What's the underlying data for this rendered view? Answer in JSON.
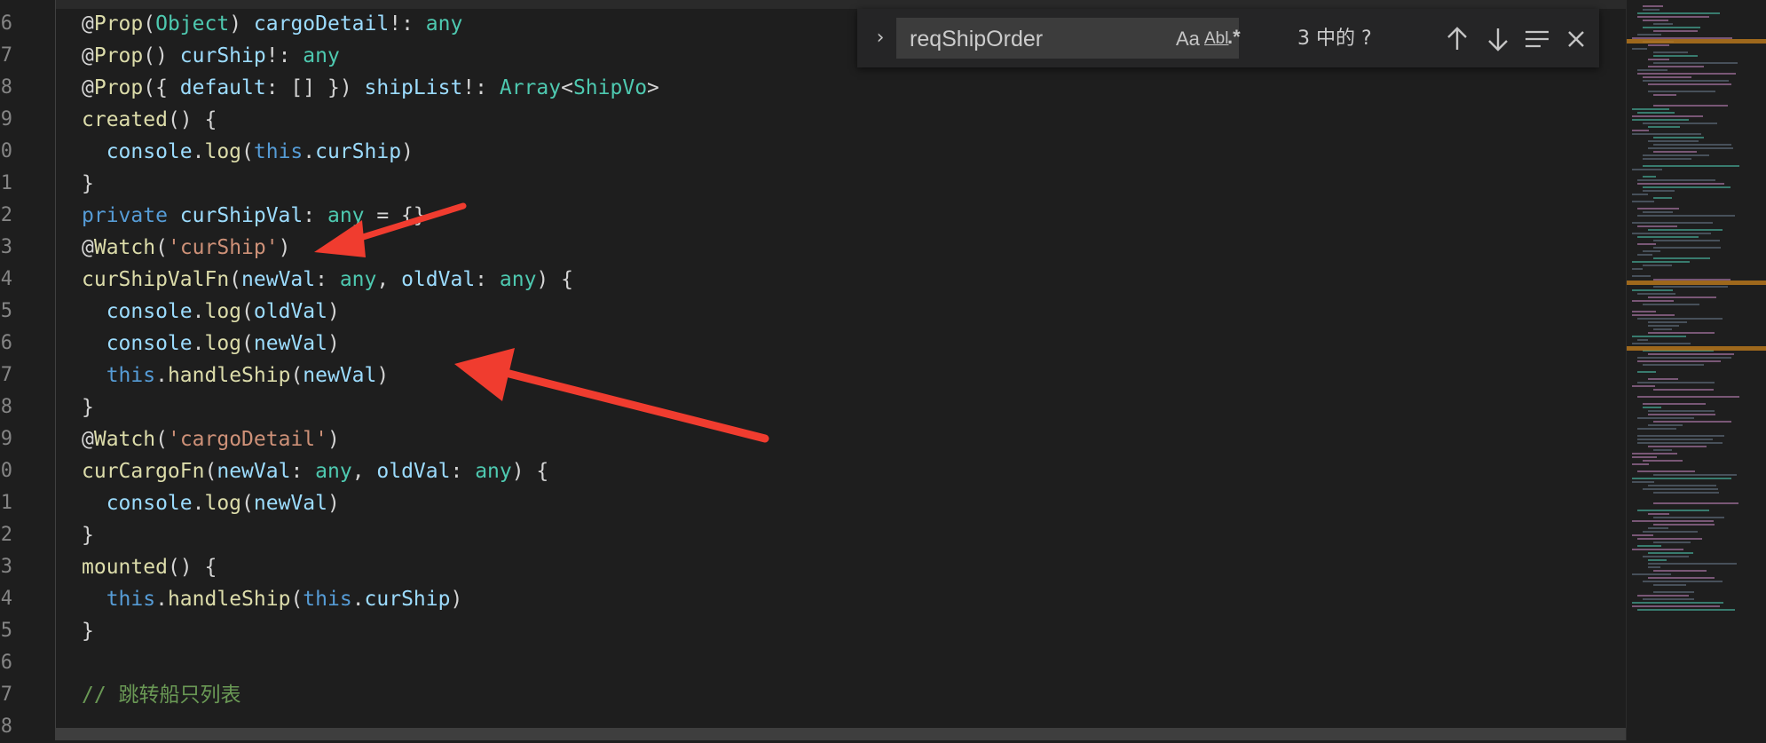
{
  "editor": {
    "line_numbers": [
      "6",
      "7",
      "8",
      "9",
      "0",
      "1",
      "2",
      "3",
      "4",
      "5",
      "6",
      "7",
      "8",
      "9",
      "0",
      "1",
      "2",
      "3",
      "4",
      "5",
      "6",
      "7",
      "8"
    ],
    "lines": [
      [
        {
          "t": "@",
          "c": "pl"
        },
        {
          "t": "Prop",
          "c": "fn"
        },
        {
          "t": "(",
          "c": "pl"
        },
        {
          "t": "Object",
          "c": "ty"
        },
        {
          "t": ") ",
          "c": "pl"
        },
        {
          "t": "cargoDetail",
          "c": "vr"
        },
        {
          "t": "!: ",
          "c": "pl"
        },
        {
          "t": "any",
          "c": "ty"
        }
      ],
      [
        {
          "t": "@",
          "c": "pl"
        },
        {
          "t": "Prop",
          "c": "fn"
        },
        {
          "t": "() ",
          "c": "pl"
        },
        {
          "t": "curShip",
          "c": "vr"
        },
        {
          "t": "!: ",
          "c": "pl"
        },
        {
          "t": "any",
          "c": "ty"
        }
      ],
      [
        {
          "t": "@",
          "c": "pl"
        },
        {
          "t": "Prop",
          "c": "fn"
        },
        {
          "t": "({ ",
          "c": "pl"
        },
        {
          "t": "default",
          "c": "vr"
        },
        {
          "t": ": [] }) ",
          "c": "pl"
        },
        {
          "t": "shipList",
          "c": "vr"
        },
        {
          "t": "!: ",
          "c": "pl"
        },
        {
          "t": "Array",
          "c": "ty"
        },
        {
          "t": "<",
          "c": "pl"
        },
        {
          "t": "ShipVo",
          "c": "ty"
        },
        {
          "t": ">",
          "c": "pl"
        }
      ],
      [
        {
          "t": "created",
          "c": "fn"
        },
        {
          "t": "() {",
          "c": "pl"
        }
      ],
      [
        {
          "t": "  console",
          "c": "vr"
        },
        {
          "t": ".",
          "c": "pl"
        },
        {
          "t": "log",
          "c": "fn"
        },
        {
          "t": "(",
          "c": "pl"
        },
        {
          "t": "this",
          "c": "kw"
        },
        {
          "t": ".",
          "c": "pl"
        },
        {
          "t": "curShip",
          "c": "vr"
        },
        {
          "t": ")",
          "c": "pl"
        }
      ],
      [
        {
          "t": "}",
          "c": "pl"
        }
      ],
      [
        {
          "t": "private ",
          "c": "kw"
        },
        {
          "t": "curShipVal",
          "c": "vr"
        },
        {
          "t": ": ",
          "c": "pl"
        },
        {
          "t": "any",
          "c": "ty"
        },
        {
          "t": " = {}",
          "c": "pl"
        }
      ],
      [
        {
          "t": "@",
          "c": "pl"
        },
        {
          "t": "Watch",
          "c": "fn"
        },
        {
          "t": "(",
          "c": "pl"
        },
        {
          "t": "'curShip'",
          "c": "st"
        },
        {
          "t": ")",
          "c": "pl"
        }
      ],
      [
        {
          "t": "curShipValFn",
          "c": "fn"
        },
        {
          "t": "(",
          "c": "pl"
        },
        {
          "t": "newVal",
          "c": "vr"
        },
        {
          "t": ": ",
          "c": "pl"
        },
        {
          "t": "any",
          "c": "ty"
        },
        {
          "t": ", ",
          "c": "pl"
        },
        {
          "t": "oldVal",
          "c": "vr"
        },
        {
          "t": ": ",
          "c": "pl"
        },
        {
          "t": "any",
          "c": "ty"
        },
        {
          "t": ") {",
          "c": "pl"
        }
      ],
      [
        {
          "t": "  console",
          "c": "vr"
        },
        {
          "t": ".",
          "c": "pl"
        },
        {
          "t": "log",
          "c": "fn"
        },
        {
          "t": "(",
          "c": "pl"
        },
        {
          "t": "oldVal",
          "c": "vr"
        },
        {
          "t": ")",
          "c": "pl"
        }
      ],
      [
        {
          "t": "  console",
          "c": "vr"
        },
        {
          "t": ".",
          "c": "pl"
        },
        {
          "t": "log",
          "c": "fn"
        },
        {
          "t": "(",
          "c": "pl"
        },
        {
          "t": "newVal",
          "c": "vr"
        },
        {
          "t": ")",
          "c": "pl"
        }
      ],
      [
        {
          "t": "  this",
          "c": "kw"
        },
        {
          "t": ".",
          "c": "pl"
        },
        {
          "t": "handleShip",
          "c": "fn"
        },
        {
          "t": "(",
          "c": "pl"
        },
        {
          "t": "newVal",
          "c": "vr"
        },
        {
          "t": ")",
          "c": "pl"
        }
      ],
      [
        {
          "t": "}",
          "c": "pl"
        }
      ],
      [
        {
          "t": "@",
          "c": "pl"
        },
        {
          "t": "Watch",
          "c": "fn"
        },
        {
          "t": "(",
          "c": "pl"
        },
        {
          "t": "'cargoDetail'",
          "c": "st"
        },
        {
          "t": ")",
          "c": "pl"
        }
      ],
      [
        {
          "t": "curCargoFn",
          "c": "fn"
        },
        {
          "t": "(",
          "c": "pl"
        },
        {
          "t": "newVal",
          "c": "vr"
        },
        {
          "t": ": ",
          "c": "pl"
        },
        {
          "t": "any",
          "c": "ty"
        },
        {
          "t": ", ",
          "c": "pl"
        },
        {
          "t": "oldVal",
          "c": "vr"
        },
        {
          "t": ": ",
          "c": "pl"
        },
        {
          "t": "any",
          "c": "ty"
        },
        {
          "t": ") {",
          "c": "pl"
        }
      ],
      [
        {
          "t": "  console",
          "c": "vr"
        },
        {
          "t": ".",
          "c": "pl"
        },
        {
          "t": "log",
          "c": "fn"
        },
        {
          "t": "(",
          "c": "pl"
        },
        {
          "t": "newVal",
          "c": "vr"
        },
        {
          "t": ")",
          "c": "pl"
        }
      ],
      [
        {
          "t": "}",
          "c": "pl"
        }
      ],
      [
        {
          "t": "mounted",
          "c": "fn"
        },
        {
          "t": "() {",
          "c": "pl"
        }
      ],
      [
        {
          "t": "  this",
          "c": "kw"
        },
        {
          "t": ".",
          "c": "pl"
        },
        {
          "t": "handleShip",
          "c": "fn"
        },
        {
          "t": "(",
          "c": "pl"
        },
        {
          "t": "this",
          "c": "kw"
        },
        {
          "t": ".",
          "c": "pl"
        },
        {
          "t": "curShip",
          "c": "vr"
        },
        {
          "t": ")",
          "c": "pl"
        }
      ],
      [
        {
          "t": "}",
          "c": "pl"
        }
      ],
      [],
      [
        {
          "t": "// 跳转船只列表",
          "c": "cm"
        }
      ],
      []
    ]
  },
  "find_widget": {
    "query": "reqShipOrder",
    "match_case_label": "Aa",
    "whole_word_label": "Abl",
    "regex_label": ".*",
    "match_count": "3 中的 ?"
  },
  "colors": {
    "background": "#1e1e1e",
    "keyword": "#569cd6",
    "type": "#4ec9b0",
    "function": "#dcdcaa",
    "variable": "#9cdcfe",
    "string": "#ce9178",
    "comment": "#6a9955",
    "annotation_arrow": "#f03c2f",
    "minimap_highlight": "#b5761c"
  }
}
